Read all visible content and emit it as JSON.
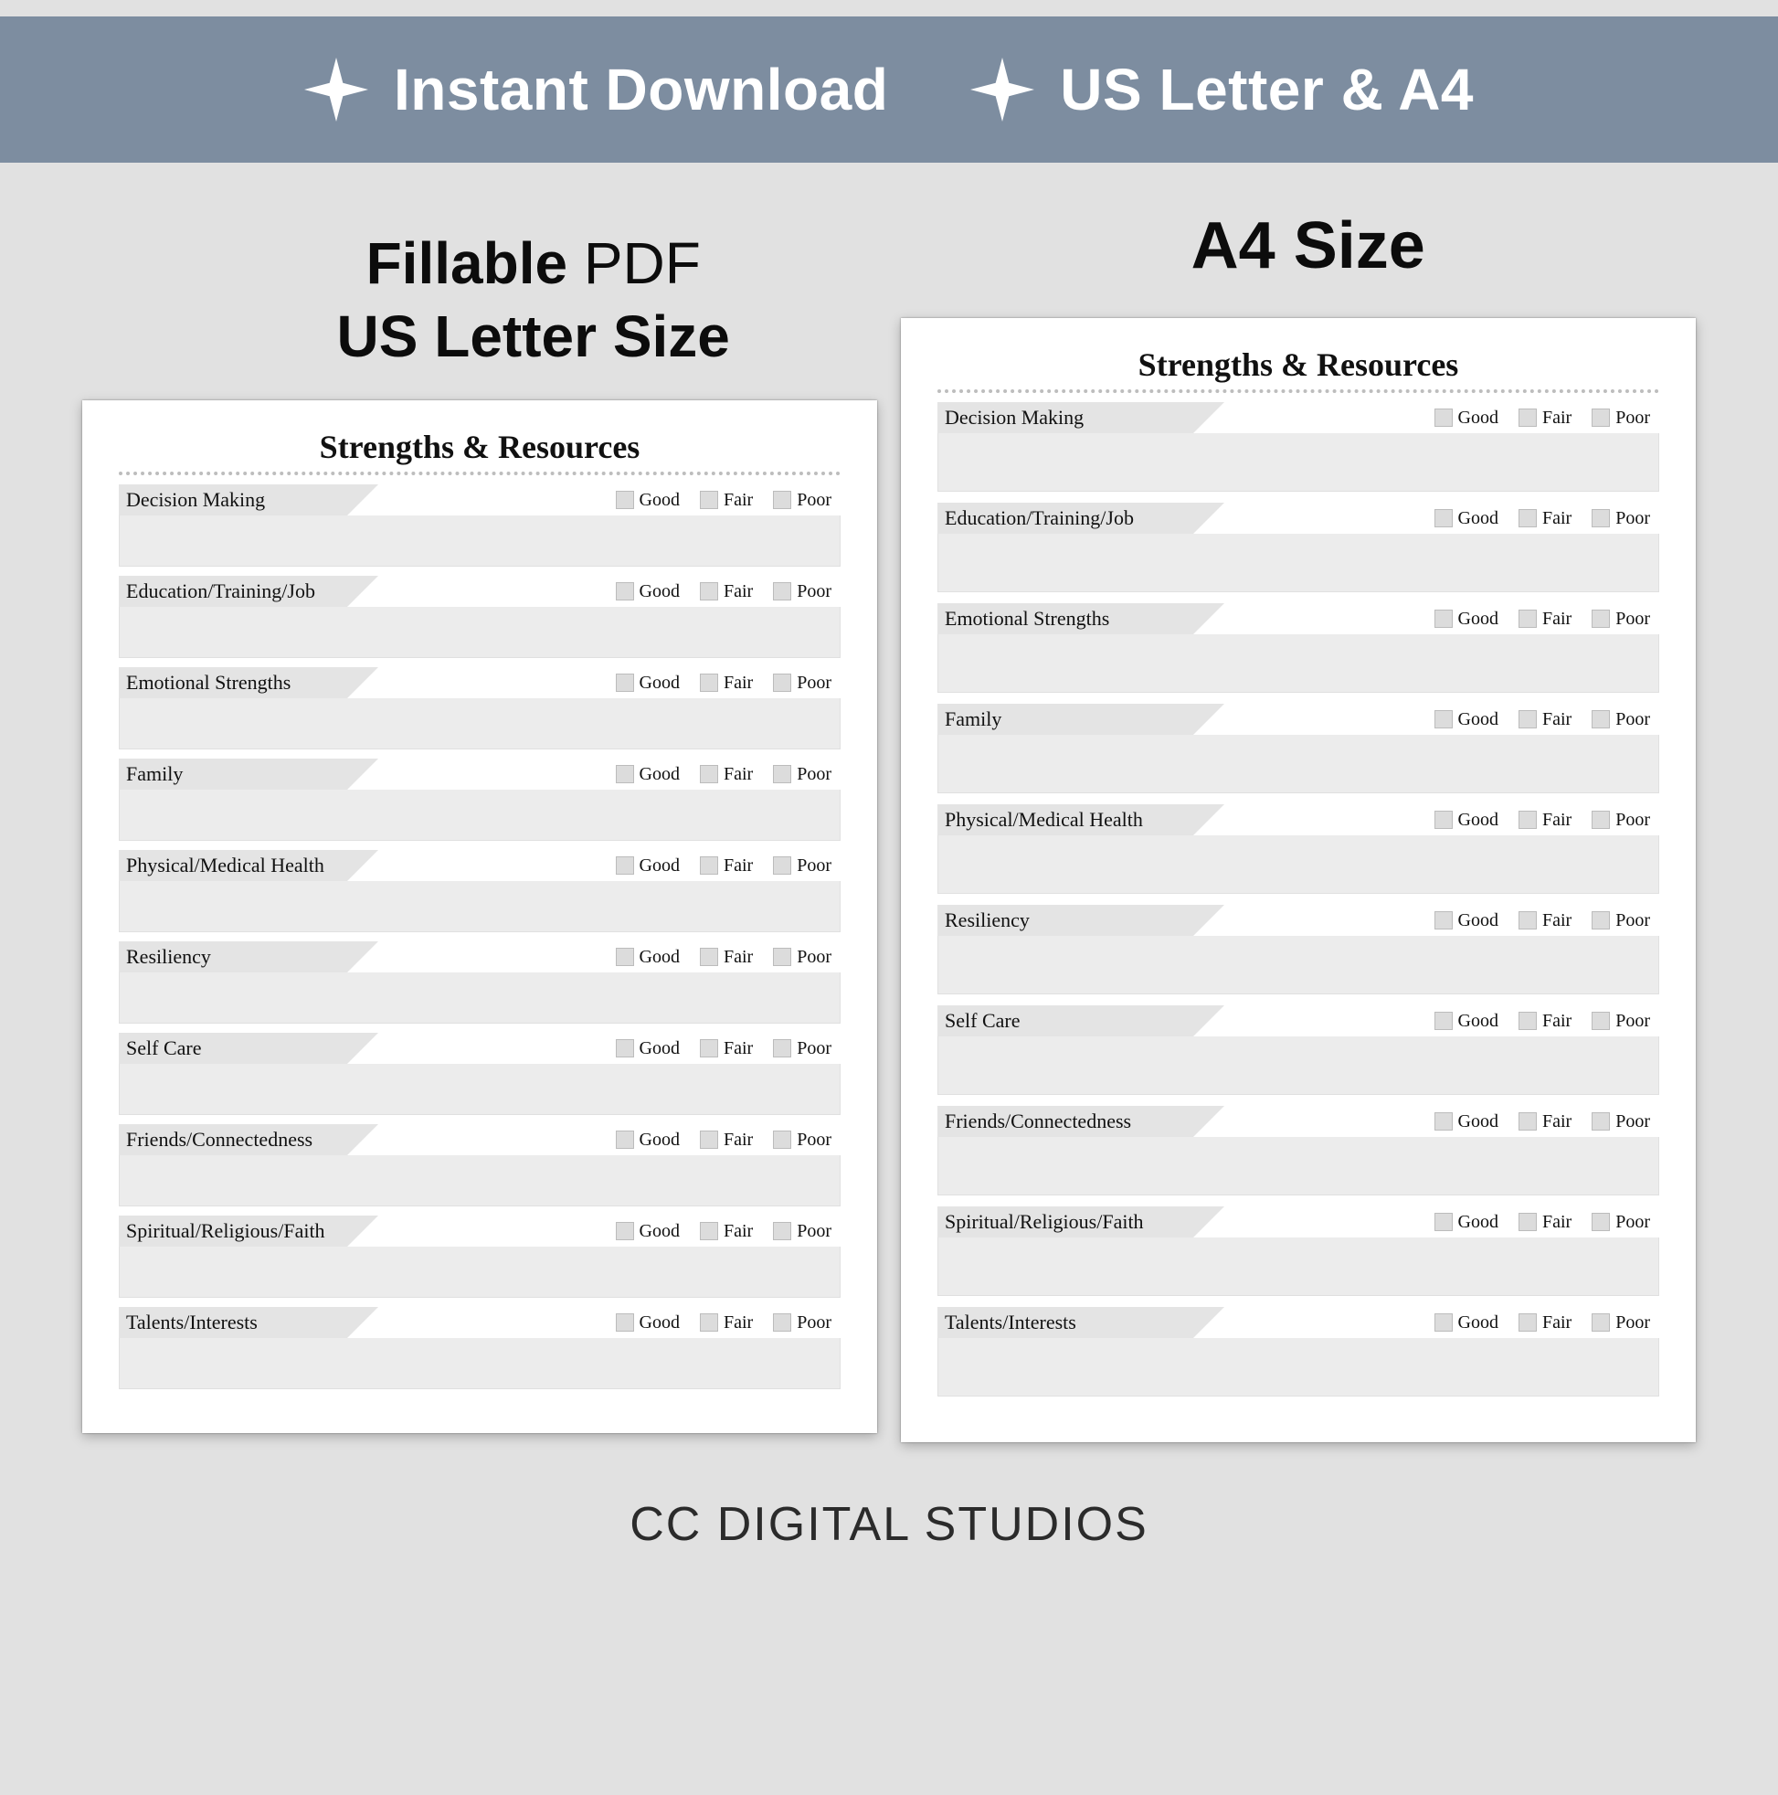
{
  "banner": {
    "item1": "Instant Download",
    "item2": "US Letter & A4"
  },
  "captions": {
    "left_bold": "Fillable",
    "left_rest": " PDF",
    "left_line2_bold": "US Letter Size",
    "right": "A4 Size"
  },
  "doc": {
    "title": "Strengths & Resources",
    "ratings": [
      "Good",
      "Fair",
      "Poor"
    ],
    "categories": [
      "Decision Making",
      "Education/Training/Job",
      "Emotional Strengths",
      "Family",
      "Physical/Medical Health",
      "Resiliency",
      "Self Care",
      "Friends/Connectedness",
      "Spiritual/Religious/Faith",
      "Talents/Interests"
    ]
  },
  "footer": "CC DIGITAL STUDIOS"
}
